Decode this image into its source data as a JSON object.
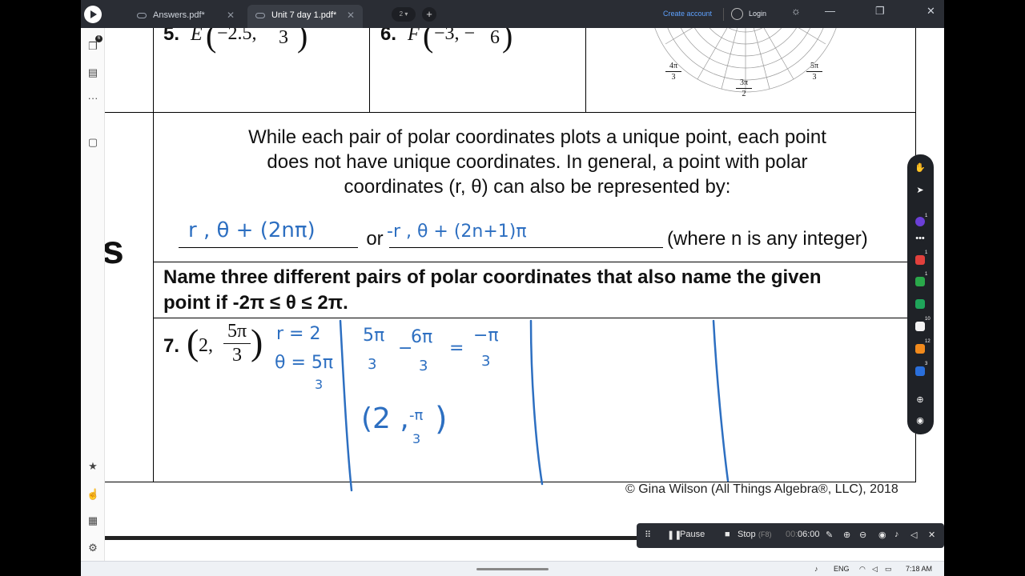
{
  "titlebar": {
    "tabs": [
      {
        "label": "Answers.pdf*"
      },
      {
        "label": "Unit 7 day 1.pdf*"
      }
    ],
    "page_pill": "2",
    "create_account": "Create account",
    "login": "Login"
  },
  "rail": {
    "badge_pages": "6",
    "more": "···"
  },
  "doc": {
    "prob5": {
      "num": "5.",
      "letter": "E",
      "coord": "−2.5,",
      "den": "3"
    },
    "prob6": {
      "num": "6.",
      "letter": "F",
      "coord": "−3, −",
      "den": "6"
    },
    "polar_labels": [
      {
        "num": "4π",
        "den": "3"
      },
      {
        "num": "3π",
        "den": "2"
      },
      {
        "num": "5π",
        "den": "3"
      }
    ],
    "paragraph": [
      "While each pair of polar coordinates plots a unique point, each point",
      "does not have unique coordinates.  In general, a point with polar",
      "coordinates (r, θ) can also be represented by:"
    ],
    "or_word": "or",
    "where_text": "(where n is any integer)",
    "side_letter": "s",
    "instruction_1": "Name three different pairs of polar coordinates that also name the given",
    "instruction_2": "point if -2π ≤ θ ≤  2π.",
    "prob7": {
      "num": "7.",
      "coord": "2,",
      "frac_num": "5π",
      "frac_den": "3"
    },
    "copyright": "© Gina Wilson (All Things Algebra®, LLC), 2018"
  },
  "handwriting": {
    "blank1": "r , θ + (2nπ)",
    "blank2": "-r , θ + (2n+1)π",
    "r_eq": "r = 2",
    "theta_eq": "θ = 5π",
    "theta_den": "3",
    "calc_a_num": "5π",
    "calc_a_den": "3",
    "minus": "−",
    "calc_b_num": "6π",
    "calc_b_den": "3",
    "equals": "=",
    "calc_c_num": "−π",
    "calc_c_den": "3",
    "answer_pre": "(2 ,",
    "answer_num": "-π",
    "answer_den": "3",
    "answer_post": ")"
  },
  "pen_toolbar": {
    "badges": [
      "1",
      "1",
      "1",
      "10",
      "12",
      "3"
    ],
    "colors": [
      "#6b3fd6",
      "#e2403c",
      "#2aa84a",
      "#1fa55a",
      "#f3f3f3",
      "#f18a1c",
      "#2a6fdb"
    ]
  },
  "recording": {
    "pause": "Pause",
    "stop": "Stop",
    "stop_hint": "(F8)",
    "time_prefix": "00:",
    "time": "06:00"
  },
  "taskbar": {
    "lang": "ENG",
    "clock": "7:18 AM"
  }
}
